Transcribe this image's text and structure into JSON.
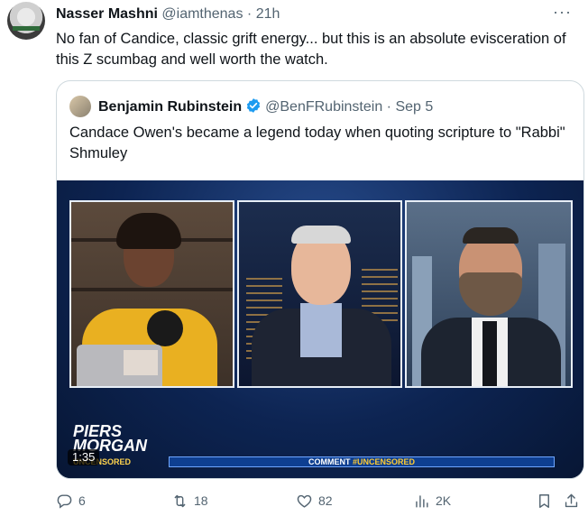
{
  "tweet": {
    "author_name": "Nasser Mashni",
    "handle": "@iamthenas",
    "separator": "·",
    "time": "21h",
    "more_icon": "more-horizontal-icon",
    "text": "No fan of Candice, classic grift energy... but this is an absolute evisceration of this Z scumbag and well worth the watch."
  },
  "quote": {
    "author_name": "Benjamin Rubinstein",
    "verified_icon": "verified-badge-icon",
    "handle": "@BenFRubinstein",
    "separator": "·",
    "date": "Sep 5",
    "text": "Candace Owen's became a legend today when quoting scripture to \"Rabbi\" Shmuley",
    "video": {
      "duration": "1:35",
      "logo_line1": "PIERS",
      "logo_line2": "MORGAN",
      "logo_line3": "UNCENSORED",
      "lower_third_a": "COMMENT",
      "lower_third_b": "#UNCENSORED"
    }
  },
  "actions": {
    "replies": "6",
    "retweets": "18",
    "likes": "82",
    "views": "2K"
  },
  "colors": {
    "text_primary": "#0f1419",
    "text_secondary": "#536471",
    "border": "#cfd9de",
    "verified": "#1d9bf0"
  }
}
